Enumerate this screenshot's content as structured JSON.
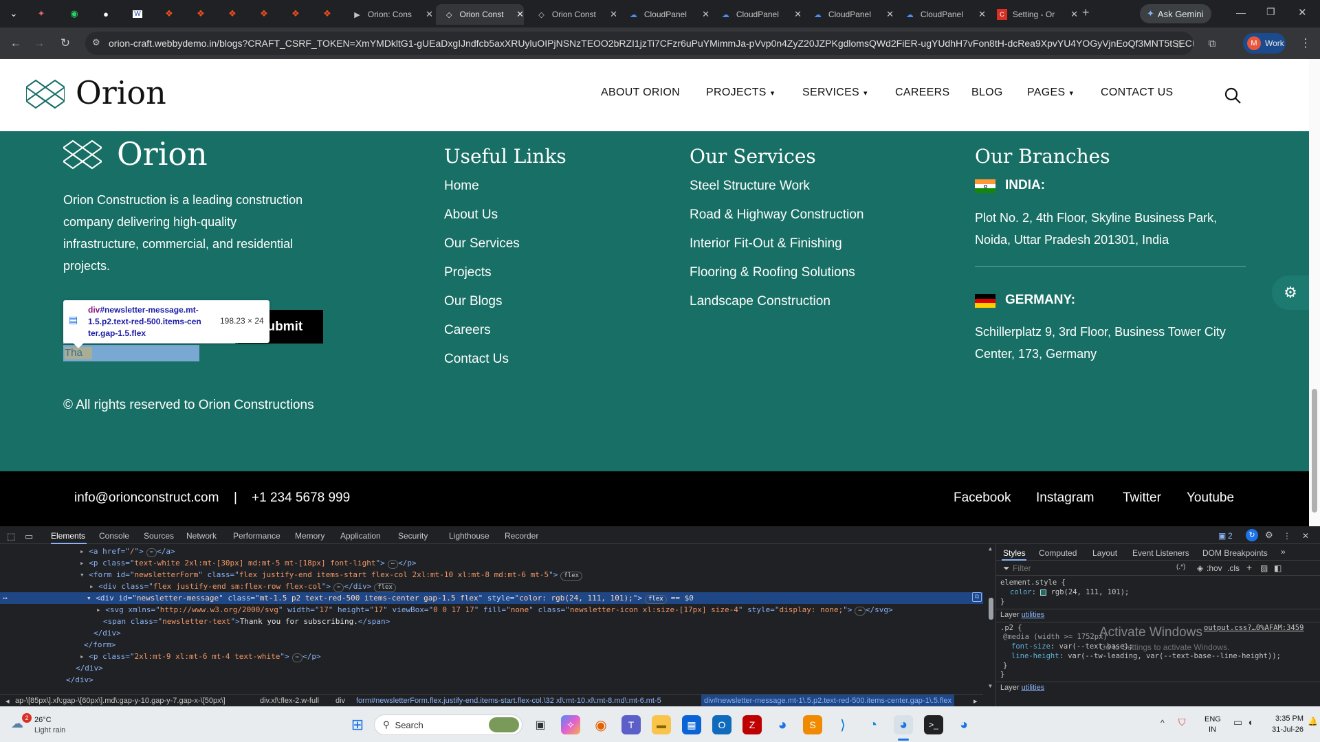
{
  "browser": {
    "tabs": [
      {
        "title": "Orion: Cons",
        "active": false
      },
      {
        "title": "Orion Const",
        "active": true
      },
      {
        "title": "Orion Const",
        "active": false
      },
      {
        "title": "CloudPanel",
        "active": false
      },
      {
        "title": "CloudPanel",
        "active": false
      },
      {
        "title": "CloudPanel",
        "active": false
      },
      {
        "title": "CloudPanel",
        "active": false
      },
      {
        "title": "Setting - Or",
        "active": false
      }
    ],
    "new_tab": "+",
    "ask_gemini": "Ask Gemini",
    "url": "orion-craft.webbydemo.in/blogs?CRAFT_CSRF_TOKEN=XmYMDkltG1-gUEaDxgIJndfcb5axXRUyluOIPjNSNzTEOO2bRZI1jzTi7CFzr6uPuYMimmJa-pVvp0n4ZyZ20JZPKgdlomsQWd2FiER-ugYUdhH7vFon8tH-dcRea9XpvYU4YOGyVjnEoQf3MNT5tSECRm...",
    "profile_initial": "M",
    "profile_label": "Work"
  },
  "site": {
    "brand": "Orion",
    "nav": [
      {
        "label": "ABOUT ORION",
        "dropdown": false
      },
      {
        "label": "PROJECTS",
        "dropdown": true
      },
      {
        "label": "SERVICES",
        "dropdown": true
      },
      {
        "label": "CAREERS",
        "dropdown": false
      },
      {
        "label": "BLOG",
        "dropdown": false
      },
      {
        "label": "PAGES",
        "dropdown": true
      },
      {
        "label": "CONTACT US",
        "dropdown": false
      }
    ],
    "footer": {
      "brand": "Orion",
      "about_lines": [
        "Orion Construction is a leading construction",
        "company delivering high-quality",
        "infrastructure, commercial, and residential",
        "projects."
      ],
      "submit_label": "Submit",
      "message_partial": "Tha",
      "copyright": "© All rights reserved to Orion Constructions",
      "useful_links_title": "Useful Links",
      "useful_links": [
        "Home",
        "About Us",
        "Our Services",
        "Projects",
        "Our Blogs",
        "Careers",
        "Contact Us"
      ],
      "services_title": "Our Services",
      "services": [
        "Steel Structure Work",
        "Road & Highway Construction",
        "Interior Fit-Out & Finishing",
        "Flooring & Roofing Solutions",
        "Landscape Construction"
      ],
      "branches_title": "Our Branches",
      "branches": [
        {
          "country": "INDIA:",
          "address_lines": [
            "Plot No. 2, 4th Floor, Skyline Business Park,",
            "Noida, Uttar Pradesh 201301, India"
          ]
        },
        {
          "country": "GERMANY:",
          "address_lines": [
            "Schillerplatz 9, 3rd Floor, Business Tower City",
            "Center, 173, Germany"
          ]
        }
      ]
    },
    "bottom": {
      "email": "info@orionconstruct.com",
      "separator": "|",
      "phone": "+1 234 5678 999",
      "socials": [
        "Facebook",
        "Instagram",
        "Twitter",
        "Youtube"
      ]
    },
    "tooltip": {
      "selector_tag": "div",
      "selector_rest_l1": "#newsletter-message.mt-",
      "selector_l2": "1.5.p2.text-red-500.items-cen",
      "selector_l3": "ter.gap-1.5.flex",
      "size": "198.23 × 24"
    }
  },
  "devtools": {
    "tabs": [
      "Elements",
      "Console",
      "Sources",
      "Network",
      "Performance",
      "Memory",
      "Application",
      "Security",
      "Lighthouse",
      "Recorder"
    ],
    "issues_count": "2",
    "code_lines": [
      {
        "a": "<a href=\"",
        "b": "/",
        "c": "\">",
        "d": "</a>"
      },
      {
        "a": "<p class=\"",
        "b": "text-white 2xl:mt-[30px] md:mt-5 mt-[18px] font-light",
        "c": "\">",
        "d": "</p>"
      },
      {
        "a": "<form id=\"",
        "b": "newsletterForm",
        "c": "\" class=\"",
        "d": "flex justify-end items-start flex-col 2xl:mt-10 xl:mt-8 md:mt-6 mt-5",
        "e": "\">",
        "pill": "flex"
      },
      {
        "a": "<div class=\"",
        "b": "flex justify-end sm:flex-row flex-col",
        "c": "\">",
        "d": "</div>",
        "pill": "flex"
      },
      {
        "a": "<div id=\"",
        "b": "newsletter-message",
        "c": "\" class=\"",
        "d": "mt-1.5 p2 text-red-500 items-center gap-1.5 flex",
        "e": "\" style=\"",
        "f": "color: rgb(24, 111, 101);",
        "g": "\">",
        "pill": "flex",
        "eq": "== $0"
      },
      {
        "a": "<svg xmlns=\"",
        "b": "http://www.w3.org/2000/svg",
        "c": "\" width=\"",
        "d": "17",
        "e": "\" height=\"",
        "f": "17",
        "g": "\" viewBox=\"",
        "h": "0 0 17 17",
        "i": "\" fill=\"",
        "j": "none",
        "k": "\" class=\"",
        "l": "newsletter-icon xl:size-[17px] size-4",
        "m": "\" style=\"",
        "n": "display: none;",
        "o": "\">",
        "p": "</svg>"
      },
      {
        "a": "<span class=\"",
        "b": "newsletter-text",
        "c": "\">",
        "d": "Thank you for subscribing.",
        "e": "</span>"
      },
      {
        "a": "</div>"
      },
      {
        "a": "</form>"
      },
      {
        "a": "<p class=\"",
        "b": "2xl:mt-9 xl:mt-6 mt-4 text-white",
        "c": "\">",
        "d": "</p>"
      },
      {
        "a": "</div>"
      },
      {
        "a": "</div>"
      }
    ],
    "breadcrumbs": [
      "ap-\\[85px\\].xl\\:gap-\\[60px\\].md\\:gap-y-10.gap-y-7.gap-x-\\[50px\\]",
      "div.xl\\:flex-2.w-full",
      "div",
      "form#newsletterForm.flex.justify-end.items-start.flex-col.\\32 xl\\:mt-10.xl\\:mt-8.md\\:mt-6.mt-5",
      "div#newsletter-message.mt-1\\.5.p2.text-red-500.items-center.gap-1\\.5.flex"
    ],
    "styles_tabs": [
      "Styles",
      "Computed",
      "Layout",
      "Event Listeners",
      "DOM Breakpoints"
    ],
    "filter_placeholder": "Filter",
    "filter_hov": ":hov",
    "filter_cls": ".cls",
    "element_style_selector": "element.style {",
    "element_style_prop": "color",
    "element_style_value": "rgb(24, 111, 101);",
    "layer_label": "Layer",
    "layer_link": "utilities",
    "rule_selector": ".p2 {",
    "rule_source": "output.css?…0%AFAM:3459",
    "media": "@media (width >= 1752px)",
    "decl1_prop": "font-size",
    "decl1_val": "var(--text-base);",
    "decl2_prop": "line-height",
    "decl2_val": "var(--tw-leading, var(--text-base--line-height));",
    "watermark_1": "Activate Windows",
    "watermark_2": "Go to Settings to activate Windows."
  },
  "taskbar": {
    "weather_temp": "26°C",
    "weather_desc": "Light rain",
    "weather_badge": "2",
    "search_label": "Search",
    "lang_1": "ENG",
    "lang_2": "IN",
    "time": "3:35 PM",
    "date": "31-Jul-26"
  },
  "colors": {
    "footer_bg": "#186f65",
    "selection": "#1f4685",
    "tab_bar": "#202124"
  }
}
